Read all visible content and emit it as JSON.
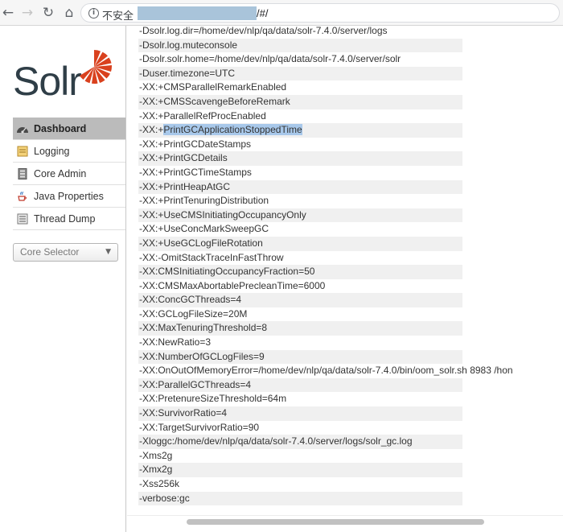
{
  "browser": {
    "insecure_label": "不安全",
    "url_suffix": "/#/",
    "back_icon": "←",
    "forward_icon": "→",
    "reload_icon": "↻",
    "home_icon": "⌂",
    "info_icon": "i"
  },
  "brand": {
    "name": "Solr",
    "color": "#2f3e47",
    "accent": "#d9411e"
  },
  "sidebar": {
    "items": [
      {
        "label": "Dashboard",
        "icon": "dashboard-icon",
        "active": true
      },
      {
        "label": "Logging",
        "icon": "logging-icon"
      },
      {
        "label": "Core Admin",
        "icon": "core-admin-icon"
      },
      {
        "label": "Java Properties",
        "icon": "java-icon"
      },
      {
        "label": "Thread Dump",
        "icon": "thread-dump-icon"
      }
    ],
    "core_selector": {
      "label": "Core Selector",
      "arrow": "▼"
    }
  },
  "jvm_args": [
    "-Dsolr.log.dir=/home/dev/nlp/qa/data/solr-7.4.0/server/logs",
    "-Dsolr.log.muteconsole",
    "-Dsolr.solr.home=/home/dev/nlp/qa/data/solr-7.4.0/server/solr",
    "-Duser.timezone=UTC",
    "-XX:+CMSParallelRemarkEnabled",
    "-XX:+CMSScavengeBeforeRemark",
    "-XX:+ParallelRefProcEnabled",
    "-XX:+PrintGCApplicationStoppedTime",
    "-XX:+PrintGCDateStamps",
    "-XX:+PrintGCDetails",
    "-XX:+PrintGCTimeStamps",
    "-XX:+PrintHeapAtGC",
    "-XX:+PrintTenuringDistribution",
    "-XX:+UseCMSInitiatingOccupancyOnly",
    "-XX:+UseConcMarkSweepGC",
    "-XX:+UseGCLogFileRotation",
    "-XX:-OmitStackTraceInFastThrow",
    "-XX:CMSInitiatingOccupancyFraction=50",
    "-XX:CMSMaxAbortablePrecleanTime=6000",
    "-XX:ConcGCThreads=4",
    "-XX:GCLogFileSize=20M",
    "-XX:MaxTenuringThreshold=8",
    "-XX:NewRatio=3",
    "-XX:NumberOfGCLogFiles=9",
    "-XX:OnOutOfMemoryError=/home/dev/nlp/qa/data/solr-7.4.0/bin/oom_solr.sh 8983 /hon",
    "-XX:ParallelGCThreads=4",
    "-XX:PretenureSizeThreshold=64m",
    "-XX:SurvivorRatio=4",
    "-XX:TargetSurvivorRatio=90",
    "-Xloggc:/home/dev/nlp/qa/data/solr-7.4.0/server/logs/solr_gc.log",
    "-Xms2g",
    "-Xmx2g",
    "-Xss256k",
    "-verbose:gc"
  ],
  "highlight": {
    "index": 7,
    "prefix": "-XX:+",
    "selected": "PrintGCApplicationStoppedTime",
    "color": "#a8c8ea"
  }
}
